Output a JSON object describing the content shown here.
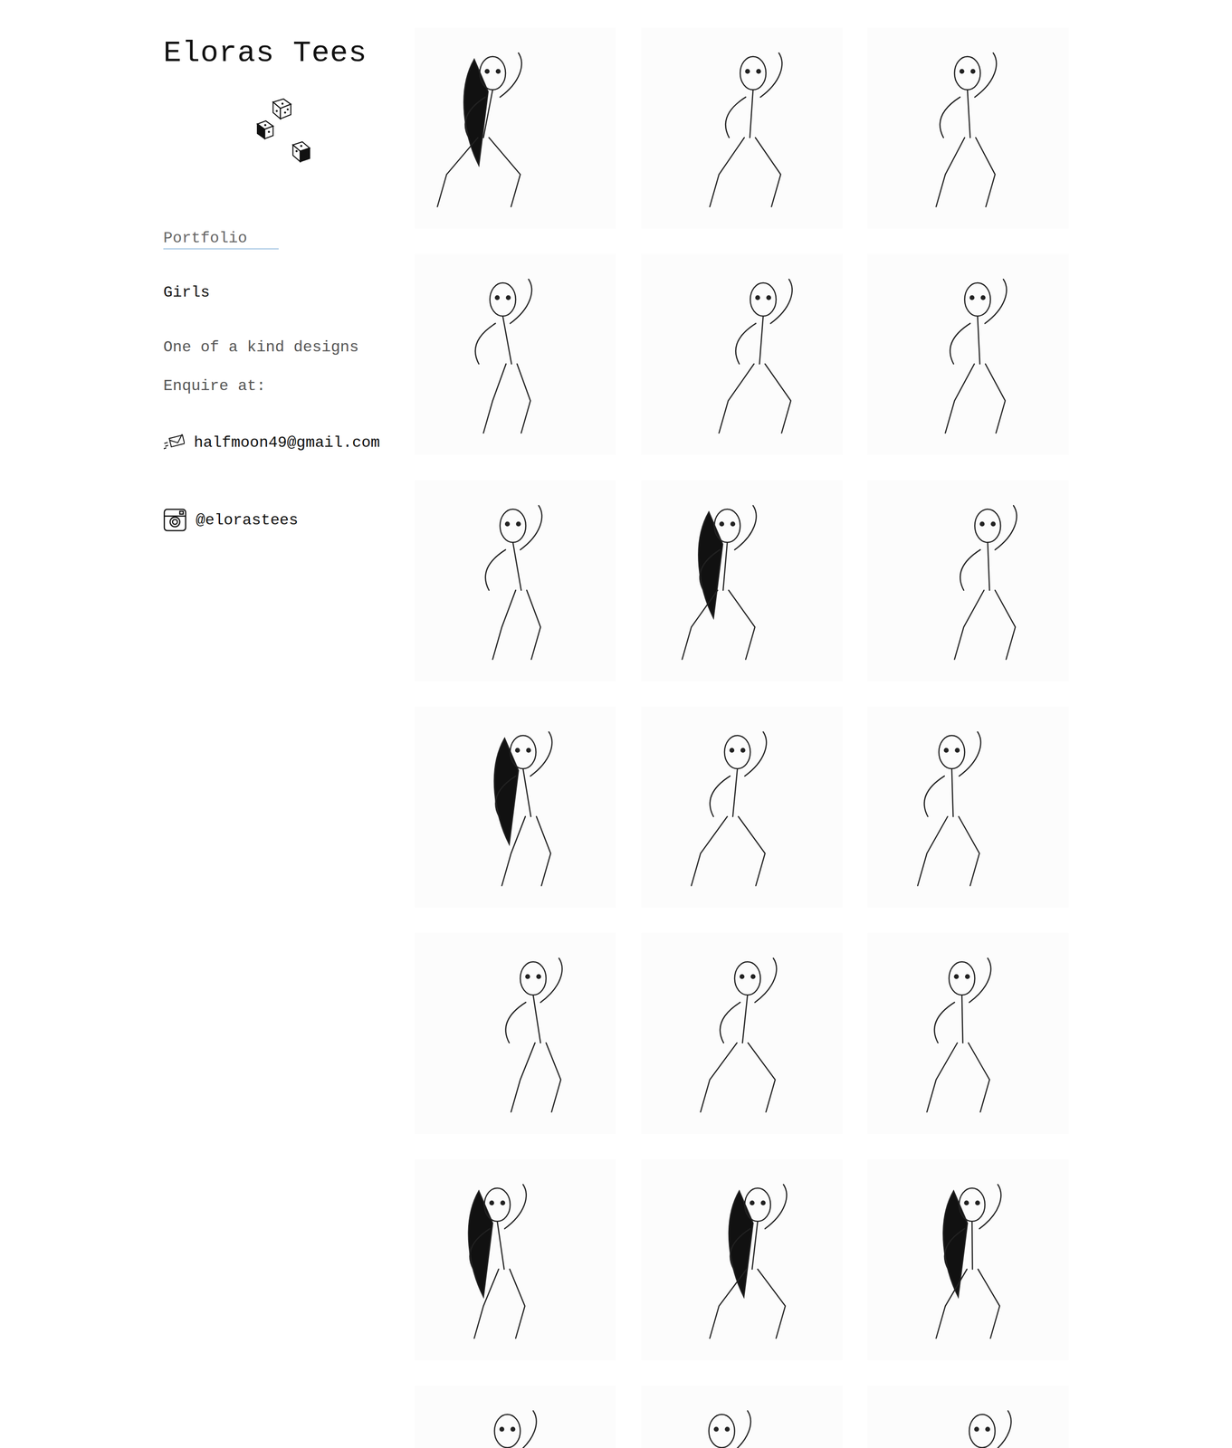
{
  "site": {
    "title": "Eloras Tees"
  },
  "nav": [
    {
      "label": "Portfolio",
      "selected": true
    }
  ],
  "section": {
    "title": "Girls"
  },
  "description": "One of a kind designs",
  "enquire": {
    "label": "Enquire at:",
    "email": "halfmoon49@gmail.com",
    "instagram": "@elorastees"
  }
}
